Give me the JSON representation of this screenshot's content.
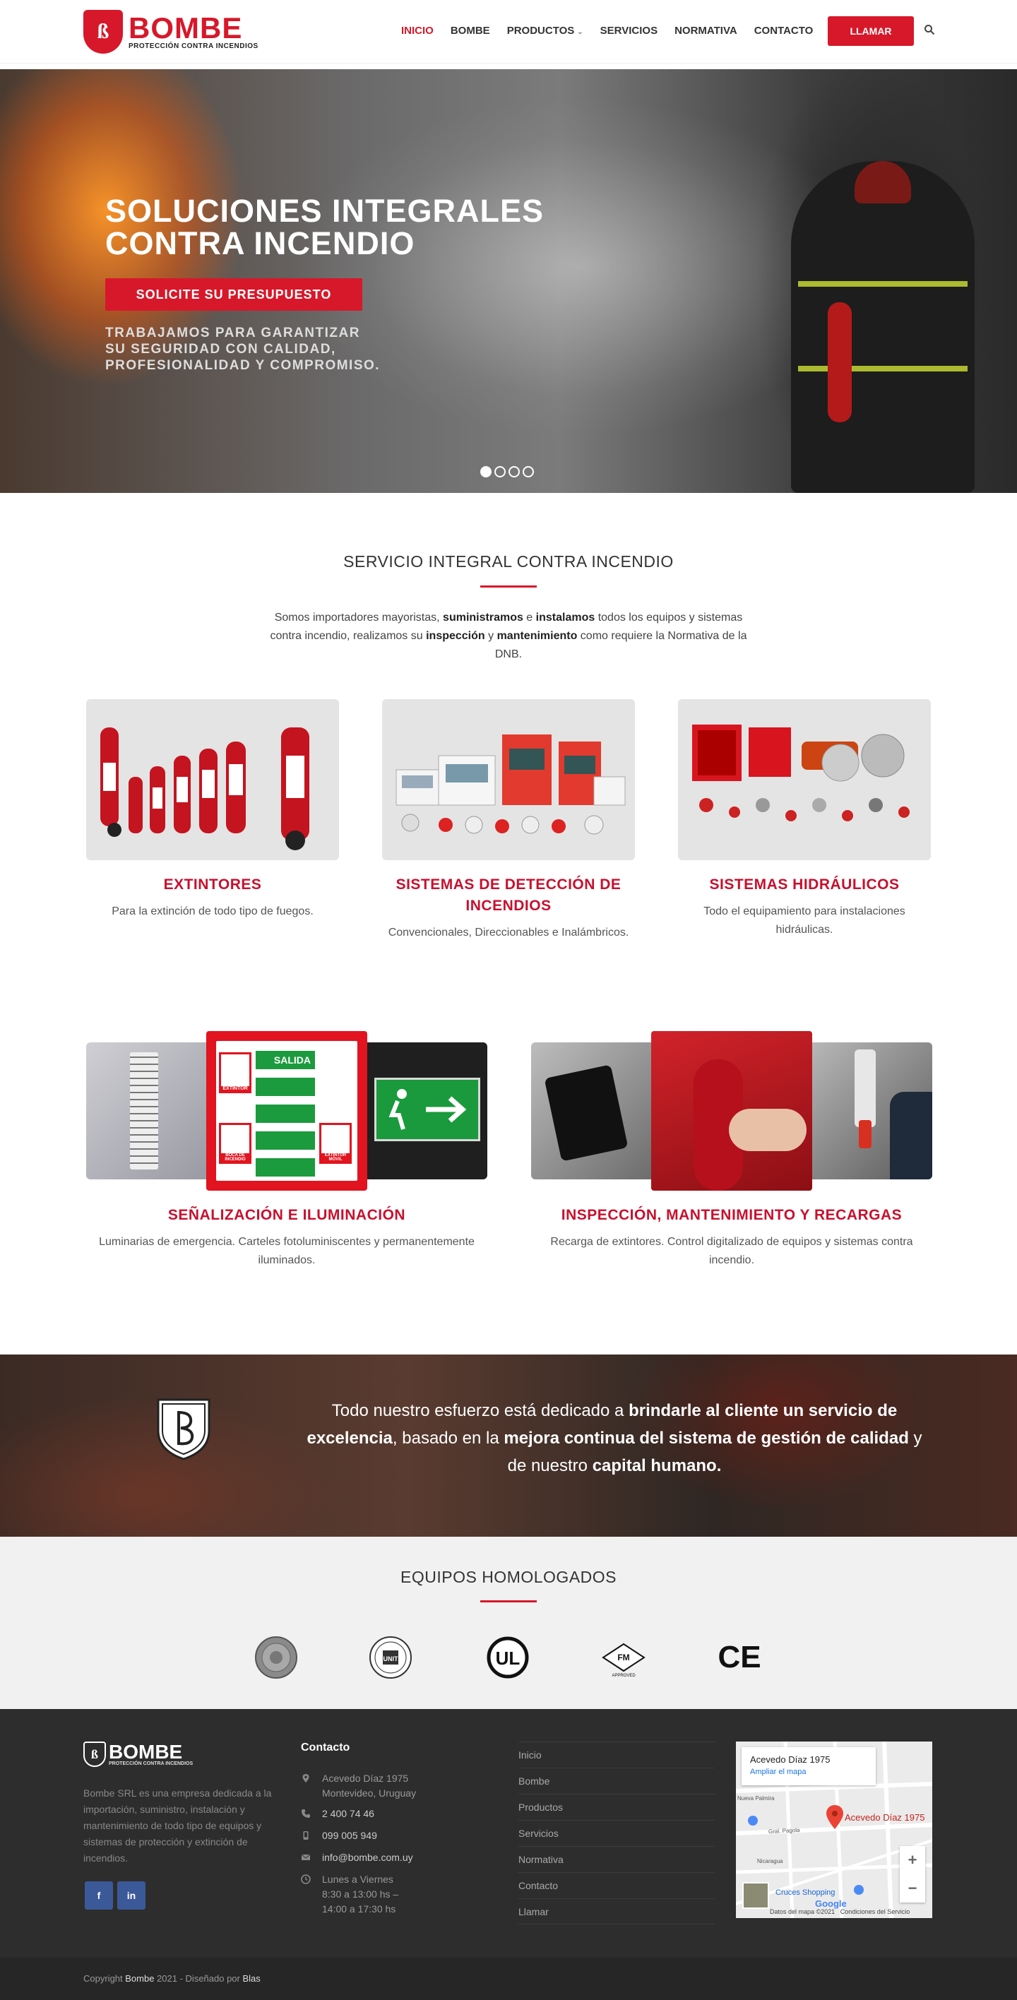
{
  "header": {
    "logo_name": "BOMBE",
    "logo_tagline": "PROTECCIÓN CONTRA INCENDIOS",
    "nav": [
      "INICIO",
      "BOMBE",
      "PRODUCTOS",
      "SERVICIOS",
      "NORMATIVA",
      "CONTACTO"
    ],
    "active_nav": "INICIO",
    "call_label": "LLAMAR",
    "search_icon": "search-icon",
    "accent_color": "#d7182a"
  },
  "hero": {
    "title_line1": "SOLUCIONES INTEGRALES",
    "title_line2": "CONTRA INCENDIO",
    "cta_label": "SOLICITE SU PRESUPUESTO",
    "subtitle_line1": "TRABAJAMOS PARA GARANTIZAR",
    "subtitle_line2": "SU SEGURIDAD CON CALIDAD,",
    "subtitle_line3": "PROFESIONALIDAD Y COMPROMISO.",
    "slides_total": 4,
    "active_slide": 1
  },
  "services": {
    "title": "SERVICIO INTEGRAL CONTRA INCENDIO",
    "intro": {
      "p1": "Somos importadores mayoristas, ",
      "b1": "suministramos",
      "p2": " e ",
      "b2": "instalamos",
      "p3": " todos los equipos y sistemas contra incendio, realizamos su ",
      "b3": "inspección",
      "p4": " y ",
      "b4": "mantenimiento",
      "p5": " como requiere la Normativa de la DNB."
    },
    "cards": [
      {
        "title": "EXTINTORES",
        "text": "Para la extinción de todo tipo de fuegos."
      },
      {
        "title": "SISTEMAS DE DETECCIÓN DE INCENDIOS",
        "text": "Convencionales, Direccionables e Inalámbricos."
      },
      {
        "title": "SISTEMAS HIDRÁULICOS",
        "text": "Todo el equipamiento para instalaciones hidráulicas."
      },
      {
        "title": "SEÑALIZACIÓN E ILUMINACIÓN",
        "text": "Luminarias de emergencia. Carteles fotoluminiscentes y permanentemente iluminados."
      },
      {
        "title": "INSPECCIÓN, MANTENIMIENTO Y RECARGAS",
        "text": "Recarga de extintores. Control digitalizado de equipos y sistemas contra incendio."
      }
    ],
    "sign_labels": [
      "SALIDA",
      "EXTINTOR",
      "BOCA DE INCENDIO",
      "EXTINTOR MÓVIL"
    ]
  },
  "quote": {
    "t1": "Todo nuestro esfuerzo está dedicado a ",
    "b1": "brindarle al cliente un servicio de excelencia",
    "t2": ", basado en la ",
    "b2": "mejora continua del sistema de gestión de calidad",
    "t3": " y de nuestro ",
    "b3": "capital humano."
  },
  "certifications": {
    "title": "EQUIPOS HOMOLOGADOS",
    "logos": [
      "seal-icon",
      "unit-icon",
      "ul-icon",
      "fm-approved-icon",
      "ce-icon"
    ],
    "unit_text": "UNIT",
    "ul_text": "UL",
    "fm_text": "FM",
    "fm_sub": "APPROVED",
    "ce_text": "CE"
  },
  "footer": {
    "logo_name": "BOMBE",
    "logo_tagline": "PROTECCIÓN CONTRA INCENDIOS",
    "about": "Bombe SRL es una empresa dedicada a la importación, suministro, instalación y mantenimiento de todo tipo de equipos y sistemas de protección y extinción de incendios.",
    "social": [
      "f",
      "in"
    ],
    "contact_title": "Contacto",
    "address_line1": "Acevedo Díaz 1975",
    "address_line2": "Montevideo, Uruguay",
    "phone": "2 400 74 46",
    "mobile": "099 005 949",
    "email": "info@bombe.com.uy",
    "hours_line1": "Lunes a Viernes",
    "hours_line2": "8:30 a 13:00 hs –",
    "hours_line3": "14:00 a 17:30 hs",
    "links": [
      "Inicio",
      "Bombe",
      "Productos",
      "Servicios",
      "Normativa",
      "Contacto",
      "Llamar"
    ],
    "map": {
      "place": "Acevedo Díaz 1975",
      "enlarge": "Ampliar el mapa",
      "pin_label": "Acevedo Díaz 1975",
      "street1": "Nueva Palmira",
      "street2": "Gral. Pagola",
      "street3": "Nicaragua",
      "street4": "Cruces Shopping",
      "attribution": "Datos del mapa ©2021",
      "terms": "Condiciones del Servicio",
      "google": "Google"
    },
    "copyright_prefix": "Copyright ",
    "copyright_brand": "Bombe",
    "copyright_mid": " 2021 - Diseñado por ",
    "copyright_designer": "Blas"
  }
}
